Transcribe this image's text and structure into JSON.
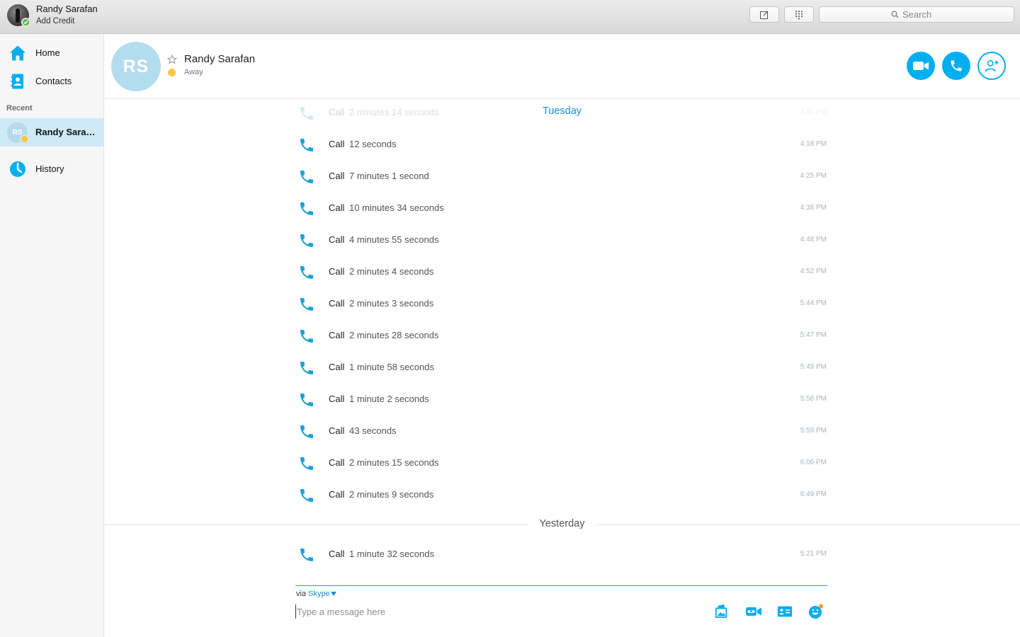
{
  "profile": {
    "name": "Randy Sarafan",
    "subtitle": "Add Credit"
  },
  "toolbar": {
    "search_placeholder": "Search"
  },
  "sidebar": {
    "home_label": "Home",
    "contacts_label": "Contacts",
    "recent_heading": "Recent",
    "recent_item": {
      "initials": "RS",
      "name": "Randy Sarafan"
    },
    "history_label": "History"
  },
  "contact": {
    "initials": "RS",
    "name": "Randy Sarafan",
    "status": "Away"
  },
  "conversation": {
    "faded_row": {
      "type": "Call",
      "duration": "2 minutes 14 seconds",
      "time": "4:15 PM"
    },
    "days": [
      {
        "label": "Tuesday",
        "calls": [
          {
            "type": "Call",
            "duration": "12 seconds",
            "time": "4:18 PM"
          },
          {
            "type": "Call",
            "duration": "7 minutes 1 second",
            "time": "4:25 PM"
          },
          {
            "type": "Call",
            "duration": "10 minutes 34 seconds",
            "time": "4:38 PM"
          },
          {
            "type": "Call",
            "duration": "4 minutes 55 seconds",
            "time": "4:48 PM"
          },
          {
            "type": "Call",
            "duration": "2 minutes 4 seconds",
            "time": "4:52 PM"
          },
          {
            "type": "Call",
            "duration": "2 minutes 3 seconds",
            "time": "5:44 PM"
          },
          {
            "type": "Call",
            "duration": "2 minutes 28 seconds",
            "time": "5:47 PM"
          },
          {
            "type": "Call",
            "duration": "1 minute 58 seconds",
            "time": "5:49 PM"
          },
          {
            "type": "Call",
            "duration": "1 minute 2 seconds",
            "time": "5:58 PM"
          },
          {
            "type": "Call",
            "duration": "43 seconds",
            "time": "5:59 PM"
          },
          {
            "type": "Call",
            "duration": "2 minutes 15 seconds",
            "time": "6:06 PM"
          },
          {
            "type": "Call",
            "duration": "2 minutes 9 seconds",
            "time": "6:49 PM"
          }
        ]
      },
      {
        "label": "Yesterday",
        "calls": [
          {
            "type": "Call",
            "duration": "1 minute 32 seconds",
            "time": "5:21 PM"
          }
        ]
      }
    ]
  },
  "composer": {
    "via_prefix": "via",
    "via_service": "Skype",
    "placeholder": "Type a message here"
  },
  "colors": {
    "accent": "#00aff0",
    "away": "#f9c73b",
    "online": "#5ab848",
    "selected_bg": "#cfe9f6",
    "tuesday_label": "#1a8fd0",
    "yesterday_label": "#555555"
  }
}
